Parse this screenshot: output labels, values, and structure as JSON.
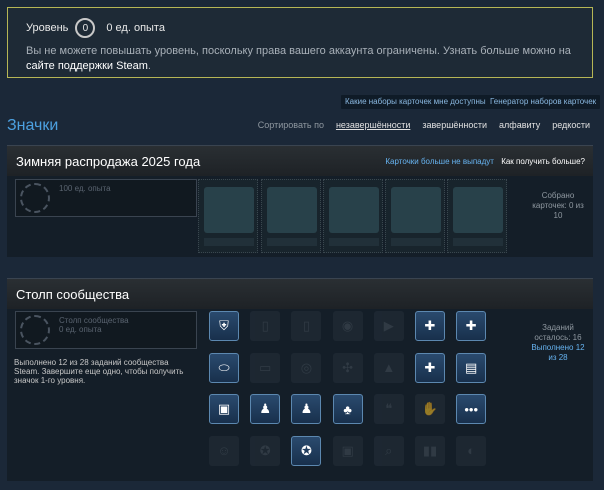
{
  "level": {
    "label": "Уровень",
    "value": "0",
    "xp": "0 ед. опыта",
    "message": "Вы не можете повышать уровень, поскольку права вашего аккаунта ограничены. Узнать больше можно на ",
    "link": "сайте поддержки Steam",
    "message_end": "."
  },
  "top_buttons": {
    "available_sets": "Какие наборы карточек мне доступны?",
    "generator": "Генератор наборов карточек"
  },
  "badges": {
    "title": "Значки",
    "sort_label": "Сортировать по",
    "sort_options": [
      "незавершённости",
      "завершённости",
      "алфавиту",
      "редкости"
    ]
  },
  "winter_sale": {
    "title": "Зимняя распродажа 2025 года",
    "no_drops": "Карточки больше не выпадут",
    "how_more": "Как получить больше?",
    "badge_xp": "100 ед. опыта",
    "collected_line1": "Собрано",
    "collected_line2": "карточек: 0 из",
    "collected_line3": "10",
    "cards": [
      "card-1",
      "card-2",
      "card-3",
      "card-4",
      "card-5"
    ]
  },
  "community": {
    "title": "Столп сообщества",
    "badge_name": "Столп сообщества",
    "badge_xp": "0 ед. опыта",
    "description": "Выполнено 12 из 28 заданий сообщества Steam. Завершите еще одно, чтобы получить значок 1-го уровня.",
    "remaining_line1": "Заданий",
    "remaining_line2": "осталось: 16",
    "done_line1": "Выполнено 12",
    "done_line2": "из 28",
    "tasks": [
      {
        "icon": "shield-icon",
        "glyph": "⛨",
        "done": true
      },
      {
        "icon": "phone-icon",
        "glyph": "▯",
        "done": false
      },
      {
        "icon": "phone-gear-icon",
        "glyph": "▯",
        "done": false
      },
      {
        "icon": "live-broadcast-icon",
        "glyph": "◉",
        "done": false
      },
      {
        "icon": "video-camera-icon",
        "glyph": "▶",
        "done": false
      },
      {
        "icon": "add-document-icon",
        "glyph": "✚",
        "done": true
      },
      {
        "icon": "add-friend-icon",
        "glyph": "✚",
        "done": true
      },
      {
        "icon": "mouse-icon",
        "glyph": "⬭",
        "done": true
      },
      {
        "icon": "screen-icon",
        "glyph": "▭",
        "done": false
      },
      {
        "icon": "camera-icon",
        "glyph": "◎",
        "done": false
      },
      {
        "icon": "gamepad-icon",
        "glyph": "✣",
        "done": false
      },
      {
        "icon": "upload-icon",
        "glyph": "▲",
        "done": false
      },
      {
        "icon": "add-item-icon",
        "glyph": "✚",
        "done": true
      },
      {
        "icon": "book-icon",
        "glyph": "▤",
        "done": true
      },
      {
        "icon": "profile-picture-icon",
        "glyph": "▣",
        "done": true
      },
      {
        "icon": "profile-background-icon",
        "glyph": "♟",
        "done": true
      },
      {
        "icon": "showcase-icon",
        "glyph": "♟",
        "done": true
      },
      {
        "icon": "group-icon",
        "glyph": "♣",
        "done": true
      },
      {
        "icon": "quote-icon",
        "glyph": "❝",
        "done": false
      },
      {
        "icon": "thumbs-up-icon",
        "glyph": "✋",
        "done": false
      },
      {
        "icon": "chat-icon",
        "glyph": "•••",
        "done": true
      },
      {
        "icon": "avatar-face-icon",
        "glyph": "☺",
        "done": false
      },
      {
        "icon": "badge-medal-icon",
        "glyph": "✪",
        "done": false
      },
      {
        "icon": "award-ribbon-icon",
        "glyph": "✪",
        "done": true
      },
      {
        "icon": "wallet-icon",
        "glyph": "▣",
        "done": false
      },
      {
        "icon": "search-icon",
        "glyph": "⌕",
        "done": false
      },
      {
        "icon": "trading-card-icon",
        "glyph": "▮▮",
        "done": false
      },
      {
        "icon": "market-icon",
        "glyph": "◐",
        "done": false
      }
    ]
  }
}
